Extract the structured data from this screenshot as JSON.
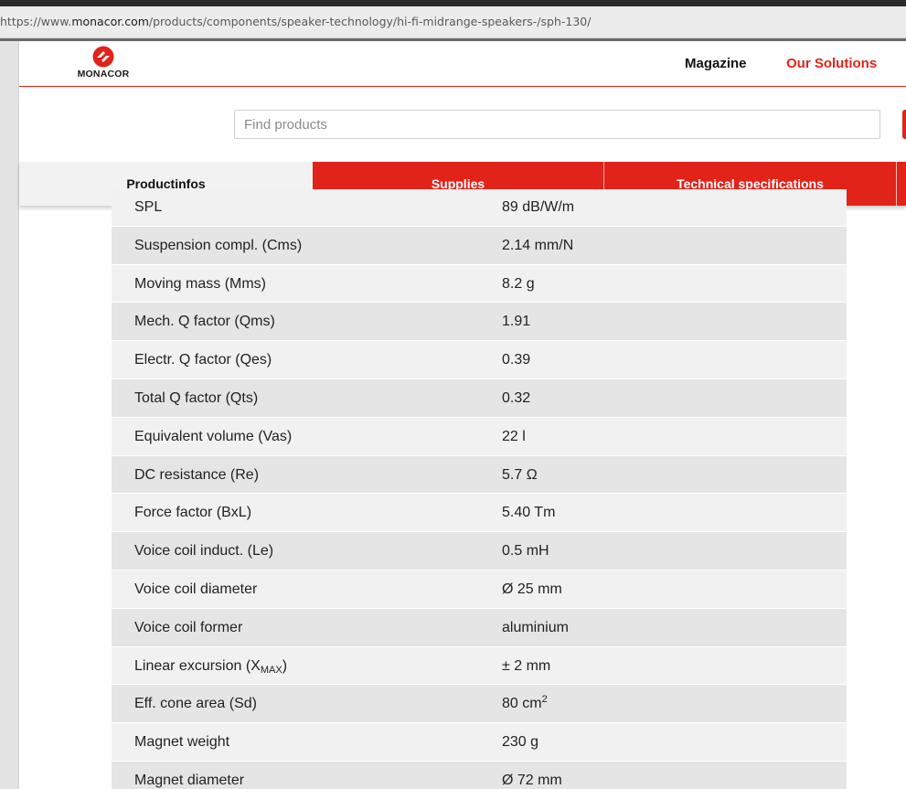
{
  "browser": {
    "url_prefix": "https://www.",
    "url_domain": "monacor.com",
    "url_path": "/products/components/speaker-technology/hi-fi-midrange-speakers-/sph-130/"
  },
  "header": {
    "logo_text": "MONACOR",
    "nav": [
      {
        "label": "Magazine"
      },
      {
        "label": "Our Solutions"
      }
    ],
    "accent_color": "#e2231a"
  },
  "search": {
    "placeholder": "Find products",
    "value": ""
  },
  "tabs": [
    {
      "label": "Productinfos",
      "active": true
    },
    {
      "label": "Supplies",
      "active": false
    },
    {
      "label": "Technical specifications",
      "active": false
    }
  ],
  "specs": [
    {
      "label": "SPL",
      "value": "89 dB/W/m"
    },
    {
      "label": "Suspension compl. (Cms)",
      "value": "2.14 mm/N"
    },
    {
      "label": "Moving mass (Mms)",
      "value": "8.2 g"
    },
    {
      "label": "Mech. Q factor (Qms)",
      "value": "1.91"
    },
    {
      "label": "Electr. Q factor (Qes)",
      "value": "0.39"
    },
    {
      "label": "Total Q factor (Qts)",
      "value": "0.32"
    },
    {
      "label": "Equivalent volume (Vas)",
      "value": "22 l"
    },
    {
      "label": "DC resistance (Re)",
      "value": "5.7 Ω"
    },
    {
      "label": "Force factor (BxL)",
      "value": "5.40 Tm"
    },
    {
      "label": "Voice coil induct. (Le)",
      "value": "0.5 mH"
    },
    {
      "label": "Voice coil diameter",
      "value": "Ø 25 mm"
    },
    {
      "label": "Voice coil former",
      "value": "aluminium"
    },
    {
      "label_main": "Linear excursion (X",
      "label_sub": "MAX",
      "label_end": ")",
      "value": "± 2 mm"
    },
    {
      "label": "Eff. cone area (Sd)",
      "value_main": "80 cm",
      "value_sup": "2"
    },
    {
      "label": "Magnet weight",
      "value": "230 g"
    },
    {
      "label": "Magnet diameter",
      "value": "Ø 72 mm"
    }
  ]
}
